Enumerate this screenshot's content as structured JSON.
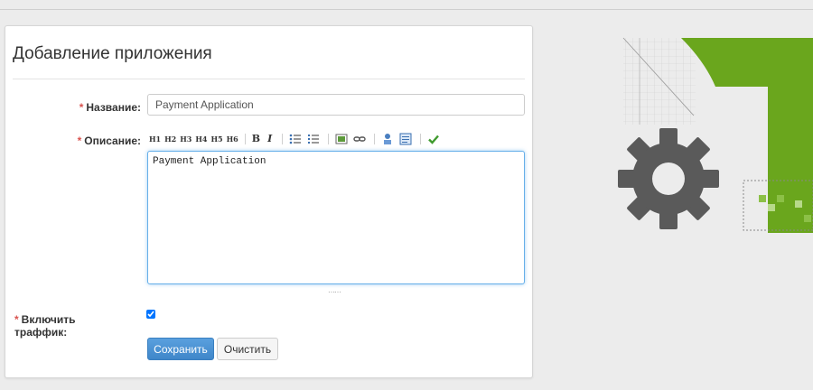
{
  "page": {
    "title": "Добавление приложения"
  },
  "form": {
    "name": {
      "label": "Название:",
      "value": "Payment Application"
    },
    "description": {
      "label": "Описание:",
      "value": "Payment Application"
    },
    "traffic": {
      "label": "Включить траффик:",
      "checked": true
    },
    "required_mark": "*"
  },
  "toolbar": {
    "headings": [
      "H1",
      "H2",
      "H3",
      "H4",
      "H5",
      "H6"
    ],
    "bold": "B",
    "italic": "I"
  },
  "actions": {
    "save_label": "Сохранить",
    "clear_label": "Очистить"
  },
  "colors": {
    "accent": "#4a8fd0",
    "brand_green": "#6aa61d",
    "gear": "#5a5a5a",
    "required": "#d9534f"
  }
}
